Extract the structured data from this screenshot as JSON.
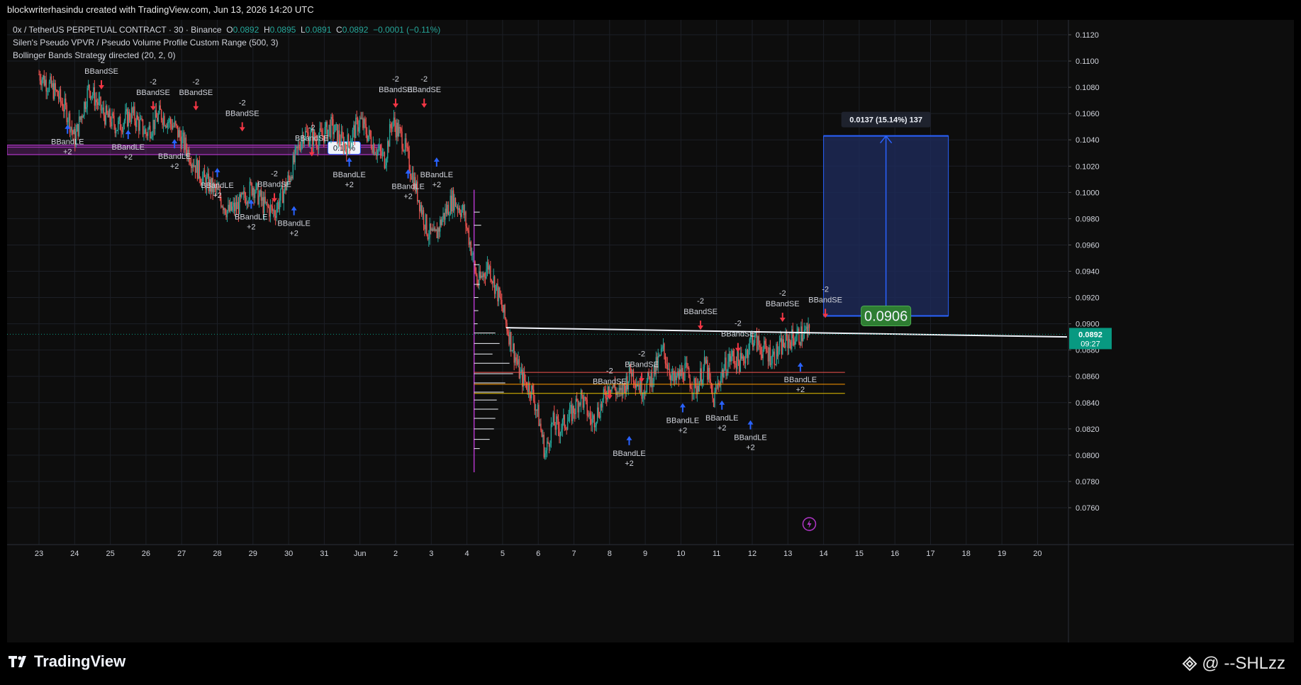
{
  "header": {
    "caption": "blockwriterhasindu created with TradingView.com, Jun 13, 2026 14:20 UTC"
  },
  "legend": {
    "symbol": "0x / TetherUS PERPETUAL CONTRACT · 30 · Binance",
    "ohlc": [
      {
        "label": "O",
        "value": "0.0892"
      },
      {
        "label": "H",
        "value": "0.0895"
      },
      {
        "label": "L",
        "value": "0.0891"
      },
      {
        "label": "C",
        "value": "0.0892"
      }
    ],
    "change": "−0.0001 (−0.11%)",
    "indicator_1": "Silen's Pseudo VPVR / Pseudo Volume Profile Custom Range (500, 3)",
    "indicator_2": "Bollinger Bands Strategy directed (20, 2, 0)"
  },
  "price_axis": {
    "current_price": "0.0892",
    "countdown": "09:27"
  },
  "measure_tool": {
    "label": "0.0137 (15.14%) 137",
    "entry_label": "0.0906"
  },
  "range_box_label": "0.10%",
  "footer": {
    "brand": "TradingView",
    "watermark": "@ --SHLzz"
  },
  "colors": {
    "up": "#26a69a",
    "down": "#ef5350",
    "signal_long": "#2962ff",
    "signal_short": "#f23645",
    "range_band": "#b136c8",
    "measure_box": "#1e2a5a",
    "entry_green": "#2e7d32",
    "price_tag": "#089981"
  },
  "chart_data": {
    "type": "candlestick",
    "y_tick_labels": [
      "0.1120",
      "0.1100",
      "0.1080",
      "0.1060",
      "0.1040",
      "0.1020",
      "0.1000",
      "0.0980",
      "0.0960",
      "0.0940",
      "0.0920",
      "0.0900",
      "0.0880",
      "0.0860",
      "0.0840",
      "0.0820",
      "0.0800",
      "0.0780",
      "0.0760"
    ],
    "ylim": [
      0.0748,
      0.113
    ],
    "x_tick_labels": [
      "23",
      "24",
      "25",
      "26",
      "27",
      "28",
      "29",
      "30",
      "31",
      "Jun",
      "2",
      "3",
      "4",
      "5",
      "6",
      "7",
      "8",
      "9",
      "10",
      "11",
      "12",
      "13",
      "14",
      "15",
      "16",
      "17",
      "18",
      "19",
      "20"
    ],
    "price_path": [
      [
        0.0,
        0.109
      ],
      [
        0.5,
        0.1075
      ],
      [
        0.8,
        0.106
      ],
      [
        1.0,
        0.104
      ],
      [
        1.4,
        0.108
      ],
      [
        1.8,
        0.106
      ],
      [
        2.2,
        0.105
      ],
      [
        2.6,
        0.106
      ],
      [
        3.0,
        0.1045
      ],
      [
        3.4,
        0.106
      ],
      [
        3.8,
        0.105
      ],
      [
        4.2,
        0.103
      ],
      [
        4.6,
        0.101
      ],
      [
        5.0,
        0.1
      ],
      [
        5.3,
        0.0985
      ],
      [
        5.6,
        0.099
      ],
      [
        6.0,
        0.1005
      ],
      [
        6.3,
        0.099
      ],
      [
        6.6,
        0.0985
      ],
      [
        7.0,
        0.101
      ],
      [
        7.4,
        0.1045
      ],
      [
        7.8,
        0.104
      ],
      [
        8.2,
        0.105
      ],
      [
        8.6,
        0.1035
      ],
      [
        9.0,
        0.1055
      ],
      [
        9.4,
        0.1035
      ],
      [
        9.7,
        0.1025
      ],
      [
        9.9,
        0.1055
      ],
      [
        10.2,
        0.104
      ],
      [
        10.5,
        0.101
      ],
      [
        10.7,
        0.099
      ],
      [
        10.9,
        0.097
      ],
      [
        11.1,
        0.0965
      ],
      [
        11.3,
        0.098
      ],
      [
        11.6,
        0.0995
      ],
      [
        11.9,
        0.0985
      ],
      [
        12.1,
        0.096
      ],
      [
        12.3,
        0.093
      ],
      [
        12.6,
        0.0945
      ],
      [
        12.9,
        0.092
      ],
      [
        13.1,
        0.09
      ],
      [
        13.3,
        0.088
      ],
      [
        13.5,
        0.086
      ],
      [
        13.8,
        0.085
      ],
      [
        14.0,
        0.083
      ],
      [
        14.2,
        0.08
      ],
      [
        14.4,
        0.0825
      ],
      [
        14.6,
        0.082
      ],
      [
        14.9,
        0.083
      ],
      [
        15.2,
        0.0845
      ],
      [
        15.5,
        0.0825
      ],
      [
        15.8,
        0.084
      ],
      [
        16.0,
        0.0855
      ],
      [
        16.3,
        0.0845
      ],
      [
        16.6,
        0.0865
      ],
      [
        16.9,
        0.085
      ],
      [
        17.2,
        0.086
      ],
      [
        17.5,
        0.088
      ],
      [
        17.8,
        0.0855
      ],
      [
        18.1,
        0.0865
      ],
      [
        18.4,
        0.085
      ],
      [
        18.7,
        0.087
      ],
      [
        18.9,
        0.084
      ],
      [
        19.1,
        0.086
      ],
      [
        19.4,
        0.0875
      ],
      [
        19.7,
        0.087
      ],
      [
        20.0,
        0.089
      ],
      [
        20.3,
        0.088
      ],
      [
        20.6,
        0.0875
      ],
      [
        20.9,
        0.0885
      ],
      [
        21.2,
        0.089
      ],
      [
        21.5,
        0.0893
      ],
      [
        21.6,
        0.0892
      ]
    ],
    "signals": [
      {
        "type": "long",
        "x": 0.8,
        "price": 0.105,
        "text": "BBandLE",
        "qty": "+2"
      },
      {
        "type": "short",
        "x": 1.75,
        "price": 0.108,
        "text": "BBandSE",
        "qty": "-2"
      },
      {
        "type": "long",
        "x": 2.5,
        "price": 0.1046,
        "text": "BBandLE",
        "qty": "+2"
      },
      {
        "type": "short",
        "x": 3.2,
        "price": 0.1064,
        "text": "BBandSE",
        "qty": "-2"
      },
      {
        "type": "long",
        "x": 3.8,
        "price": 0.1039,
        "text": "BBandLE",
        "qty": "+2"
      },
      {
        "type": "short",
        "x": 4.4,
        "price": 0.1064,
        "text": "BBandSE",
        "qty": "-2"
      },
      {
        "type": "long",
        "x": 5.0,
        "price": 0.1017,
        "text": "BBandLE",
        "qty": "+2"
      },
      {
        "type": "short",
        "x": 5.7,
        "price": 0.1048,
        "text": "BBandSE",
        "qty": "-2"
      },
      {
        "type": "long",
        "x": 5.95,
        "price": 0.0993,
        "text": "BBandLE",
        "qty": "+2"
      },
      {
        "type": "short",
        "x": 6.6,
        "price": 0.0994,
        "text": "BBandSE",
        "qty": "-2"
      },
      {
        "type": "long",
        "x": 7.15,
        "price": 0.0988,
        "text": "BBandLE",
        "qty": "+2"
      },
      {
        "type": "short",
        "x": 7.65,
        "price": 0.1029,
        "text": "BBandSE",
        "qty": "-2"
      },
      {
        "type": "long",
        "x": 8.7,
        "price": 0.1025,
        "text": "BBandLE",
        "qty": "+2"
      },
      {
        "type": "short",
        "x": 10.0,
        "price": 0.1066,
        "text": "BBandSE",
        "qty": "-2"
      },
      {
        "type": "short",
        "x": 10.8,
        "price": 0.1066,
        "text": "BBandSE",
        "qty": "-2"
      },
      {
        "type": "long",
        "x": 10.35,
        "price": 0.1016,
        "text": "BBandLE",
        "qty": "+2"
      },
      {
        "type": "long",
        "x": 11.15,
        "price": 0.1025,
        "text": "BBandLE",
        "qty": "+2"
      },
      {
        "type": "short",
        "x": 16.0,
        "price": 0.0844,
        "text": "BBandSE",
        "qty": "-2"
      },
      {
        "type": "short",
        "x": 16.9,
        "price": 0.0857,
        "text": "BBandSE",
        "qty": "-2"
      },
      {
        "type": "long",
        "x": 16.55,
        "price": 0.0813,
        "text": "BBandLE",
        "qty": "+2"
      },
      {
        "type": "short",
        "x": 18.55,
        "price": 0.0897,
        "text": "BBandSE",
        "qty": "-2"
      },
      {
        "type": "long",
        "x": 18.05,
        "price": 0.0838,
        "text": "BBandLE",
        "qty": "+2"
      },
      {
        "type": "long",
        "x": 19.15,
        "price": 0.084,
        "text": "BBandLE",
        "qty": "+2"
      },
      {
        "type": "short",
        "x": 19.6,
        "price": 0.088,
        "text": "BBandSE",
        "qty": "-2"
      },
      {
        "type": "long",
        "x": 19.95,
        "price": 0.0825,
        "text": "BBandLE",
        "qty": "+2"
      },
      {
        "type": "short",
        "x": 20.85,
        "price": 0.0903,
        "text": "BBandSE",
        "qty": "-2"
      },
      {
        "type": "long",
        "x": 21.35,
        "price": 0.0869,
        "text": "BBandLE",
        "qty": "+2"
      },
      {
        "type": "short",
        "x": 22.05,
        "price": 0.0906,
        "text": "BBandSE",
        "qty": "-2"
      }
    ]
  }
}
